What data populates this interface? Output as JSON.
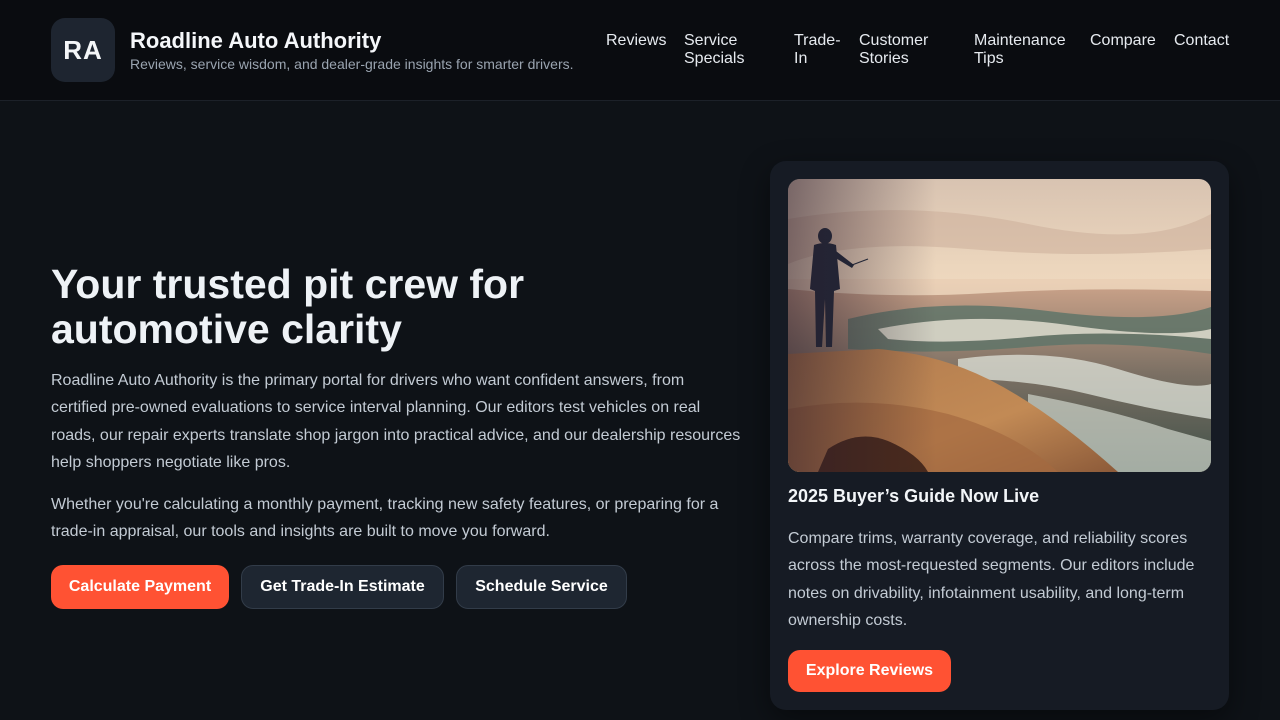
{
  "header": {
    "logo_initials": "RA",
    "brand_title": "Roadline Auto Authority",
    "brand_tagline": "Reviews, service wisdom, and dealer-grade insights for smarter drivers."
  },
  "nav": {
    "reviews": "Reviews",
    "service_specials_1": "Service",
    "service_specials_2": "Specials",
    "trade_in_1": "Trade-",
    "trade_in_2": "In",
    "customer_stories_1": "Customer",
    "customer_stories_2": "Stories",
    "maintenance_tips_1": "Maintenance",
    "maintenance_tips_2": "Tips",
    "compare": "Compare",
    "contact": "Contact"
  },
  "hero": {
    "title": "Your trusted pit crew for automotive clarity",
    "paragraph_1": "Roadline Auto Authority is the primary portal for drivers who want confident answers, from certified pre-owned evaluations to service interval planning. Our editors test vehicles on real roads, our repair experts translate shop jargon into practical advice, and our dealership resources help shoppers negotiate like pros.",
    "paragraph_2": "Whether you're calculating a monthly payment, tracking new safety features, or preparing for a trade-in appraisal, our tools and insights are built to move you forward.",
    "buttons": {
      "calculate": "Calculate Payment",
      "trade_in": "Get Trade-In Estimate",
      "schedule": "Schedule Service"
    }
  },
  "card": {
    "title": "2025 Buyer’s Guide Now Live",
    "description": "Compare trims, warranty coverage, and reliability scores across the most-requested segments. Our editors include notes on drivability, infotainment usability, and long-term ownership costs.",
    "button": "Explore Reviews"
  },
  "colors": {
    "accent": "#ff5233",
    "background": "#0e1217",
    "header_background": "#0a0c10",
    "card_background": "#161b24"
  }
}
